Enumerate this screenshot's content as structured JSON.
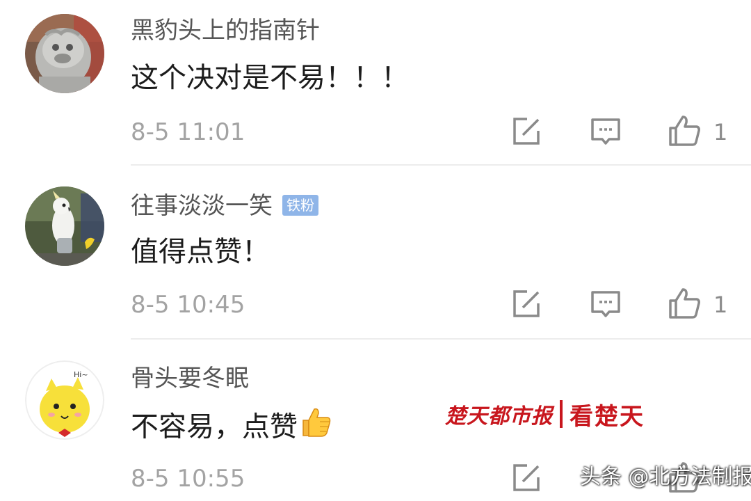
{
  "comments": [
    {
      "username": "黑豹头上的指南针",
      "text": "这个决对是不易！！！",
      "time": "8-5 11:01",
      "likes": "1",
      "avatar_icon": "stone-lion-avatar"
    },
    {
      "username": "往事淡淡一笑",
      "badge": "铁粉",
      "text": "值得点赞！",
      "time": "8-5 10:45",
      "likes": "1",
      "avatar_icon": "cockatoo-avatar"
    },
    {
      "username": "骨头要冬眠",
      "text": "不容易，点赞",
      "time": "8-5 10:55",
      "avatar_icon": "yellow-chick-avatar",
      "avatar_text": "Hi~"
    }
  ],
  "icons": {
    "repost": "repost-icon",
    "reply": "comment-icon",
    "like": "thumbs-up-icon",
    "inline_emoji": "thumbs-up-emoji"
  },
  "watermarks": {
    "red_left": "楚天都市报",
    "red_right": "看楚天",
    "bottom": "头条 @北方法制报"
  },
  "colors": {
    "username": "#555555",
    "time": "#a3a3a3",
    "badge_bg": "#8fb5e8",
    "watermark_red": "#c8161d"
  }
}
